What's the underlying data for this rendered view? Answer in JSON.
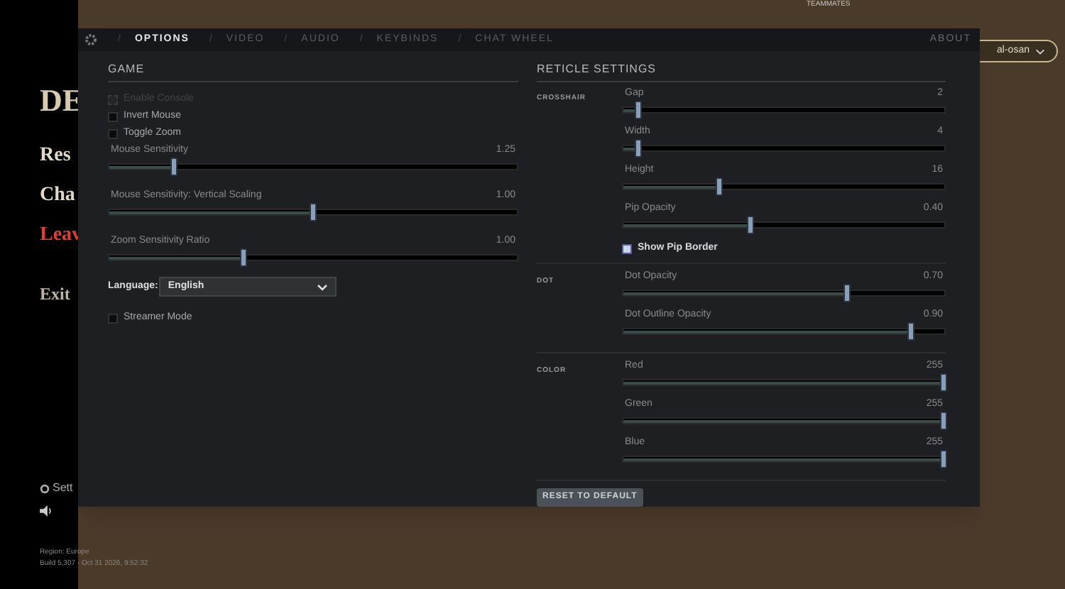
{
  "background": {
    "logo": "DE",
    "menu": [
      {
        "label": "Res",
        "danger": false
      },
      {
        "label": "Cha",
        "danger": false
      },
      {
        "label": "Leav",
        "danger": true
      }
    ],
    "exit": "Exit",
    "settings": "Sett",
    "region": "Region: Europe",
    "build": "Build 5,307 - Oct 31 2026, 9:52:32",
    "teammates": "TEAMMATES",
    "player_select": "al-osan"
  },
  "tabs": [
    {
      "label": "OPTIONS",
      "separator": "/",
      "selected": true
    },
    {
      "label": "VIDEO",
      "separator": "/",
      "selected": false
    },
    {
      "label": "AUDIO",
      "separator": "/",
      "selected": false
    },
    {
      "label": "KEYBINDS",
      "separator": "/",
      "selected": false
    },
    {
      "label": "CHAT WHEEL",
      "separator": "/",
      "selected": false
    }
  ],
  "about": "ABOUT",
  "game": {
    "title": "GAME",
    "checkboxes": [
      {
        "label": "Enable Console",
        "checked": false,
        "disabled": true
      },
      {
        "label": "Invert Mouse",
        "checked": false,
        "disabled": false
      },
      {
        "label": "Toggle Zoom",
        "checked": false,
        "disabled": false
      }
    ],
    "sliders": [
      {
        "label": "Mouse Sensitivity",
        "reading": "1.25",
        "level": 0.16
      },
      {
        "label": "Mouse Sensitivity: Vertical Scaling",
        "reading": "1.00",
        "level": 0.5
      },
      {
        "label": "Zoom Sensitivity Ratio",
        "reading": "1.00",
        "level": 0.33
      }
    ],
    "language": {
      "label": "Language:",
      "value": "English"
    },
    "streamer_mode": {
      "label": "Streamer Mode",
      "checked": false,
      "disabled": false
    }
  },
  "reticle": {
    "title": "RETICLE SETTINGS",
    "groups": [
      {
        "label": "CROSSHAIR",
        "sliders": [
          {
            "label": "Gap",
            "reading": "2",
            "level": 0.05
          },
          {
            "label": "Width",
            "reading": "4",
            "level": 0.05
          },
          {
            "label": "Height",
            "reading": "16",
            "level": 0.3
          },
          {
            "label": "Pip Opacity",
            "reading": "0.40",
            "level": 0.4
          }
        ],
        "checkbox": {
          "label": "Show Pip Border",
          "checked": true,
          "disabled": false
        }
      },
      {
        "label": "DOT",
        "sliders": [
          {
            "label": "Dot Opacity",
            "reading": "0.70",
            "level": 0.7
          },
          {
            "label": "Dot Outline Opacity",
            "reading": "0.90",
            "level": 0.9
          }
        ]
      },
      {
        "label": "COLOR",
        "sliders": [
          {
            "label": "Red",
            "reading": "255",
            "level": 1
          },
          {
            "label": "Green",
            "reading": "255",
            "level": 1
          },
          {
            "label": "Blue",
            "reading": "255",
            "level": 1
          }
        ]
      }
    ],
    "reset": "RESET TO DEFAULT"
  }
}
